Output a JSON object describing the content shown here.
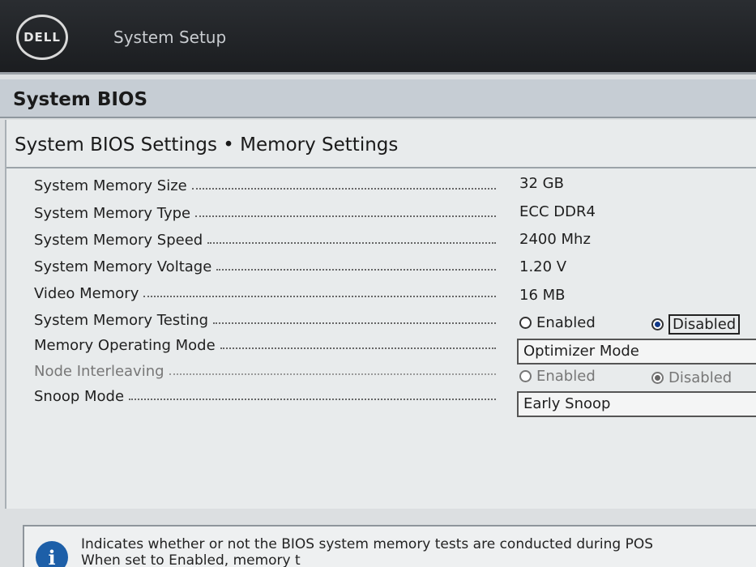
{
  "header": {
    "logo_text": "DELL",
    "app_title": "System Setup"
  },
  "band": {
    "title": "System BIOS"
  },
  "page": {
    "subtitle": "System BIOS Settings • Memory Settings"
  },
  "settings": {
    "memory_size": {
      "label": "System Memory Size",
      "value": "32 GB"
    },
    "memory_type": {
      "label": "System Memory Type",
      "value": "ECC DDR4"
    },
    "memory_speed": {
      "label": "System Memory Speed",
      "value": "2400 Mhz"
    },
    "memory_voltage": {
      "label": "System Memory Voltage",
      "value": "1.20 V"
    },
    "video_memory": {
      "label": "Video Memory",
      "value": "16 MB"
    },
    "memory_testing": {
      "label": "System Memory Testing",
      "options": [
        "Enabled",
        "Disabled"
      ],
      "selected": "Disabled"
    },
    "operating_mode": {
      "label": "Memory Operating Mode",
      "value": "Optimizer Mode"
    },
    "node_interleaving": {
      "label": "Node Interleaving",
      "options": [
        "Enabled",
        "Disabled"
      ],
      "selected": "Disabled",
      "disabled": true
    },
    "snoop_mode": {
      "label": "Snoop Mode",
      "value": "Early Snoop"
    }
  },
  "help": {
    "icon": "info-icon",
    "line1": "Indicates whether or not the BIOS system memory tests are conducted during POS",
    "line2": "When set to Enabled, memory t"
  },
  "colors": {
    "header_bg": "#1b1d20",
    "band_bg": "#c6cdd4",
    "panel_bg": "#e8ebec",
    "accent": "#1d5fa8"
  }
}
